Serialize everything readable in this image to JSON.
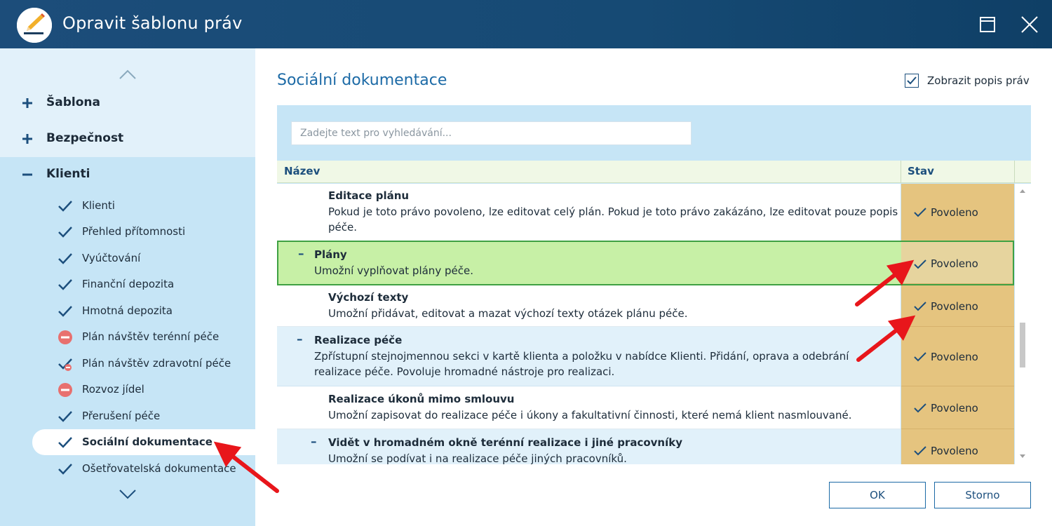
{
  "window": {
    "title": "Opravit šablonu práv"
  },
  "sidebar": {
    "groups": [
      {
        "label": "Šablona",
        "sign": "plus"
      },
      {
        "label": "Bezpečnost",
        "sign": "plus"
      },
      {
        "label": "Klienti",
        "sign": "minus"
      }
    ],
    "items": [
      {
        "label": "Klienti",
        "icon": "check-icon"
      },
      {
        "label": "Přehled přítomnosti",
        "icon": "check-icon"
      },
      {
        "label": "Vyúčtování",
        "icon": "check-icon"
      },
      {
        "label": "Finanční depozita",
        "icon": "check-icon"
      },
      {
        "label": "Hmotná depozita",
        "icon": "check-icon"
      },
      {
        "label": "Plán návštěv terénní péče",
        "icon": "denied-icon"
      },
      {
        "label": "Plán návštěv zdravotní péče",
        "icon": "partial-check-icon"
      },
      {
        "label": "Rozvoz jídel",
        "icon": "denied-icon"
      },
      {
        "label": "Přerušení péče",
        "icon": "check-icon"
      },
      {
        "label": "Sociální dokumentace",
        "icon": "check-icon",
        "selected": true
      },
      {
        "label": "Ošetřovatelská dokumentace",
        "icon": "check-icon"
      }
    ]
  },
  "main": {
    "title": "Sociální dokumentace",
    "show_description_label": "Zobrazit popis práv",
    "show_description_checked": true,
    "search_placeholder": "Zadejte text pro vyhledávání..."
  },
  "grid": {
    "columns": {
      "name": "Název",
      "status": "Stav"
    },
    "rows": [
      {
        "title": "Editace plánu",
        "description": "Pokud je toto právo povoleno, lze editovat celý plán. Pokud je toto právo zakázáno, lze editovat pouze popis péče.",
        "status": "Povoleno"
      },
      {
        "title": "Plány",
        "description": "Umožní vyplňovat plány péče.",
        "status": "Povoleno"
      },
      {
        "title": "Výchozí texty",
        "description": "Umožní přidávat, editovat a mazat výchozí texty otázek plánu péče.",
        "status": "Povoleno"
      },
      {
        "title": "Realizace péče",
        "description": "Zpřístupní stejnojmennou sekci v kartě klienta a položku v nabídce Klienti. Přidání, oprava a odebrání realizace péče. Povoluje hromadné nástroje pro realizaci.",
        "status": "Povoleno"
      },
      {
        "title": "Realizace úkonů mimo smlouvu",
        "description": "Umožní zapisovat do realizace péče i úkony a fakultativní činnosti, které nemá klient nasmlouvané.",
        "status": "Povoleno"
      },
      {
        "title": "Vidět v hromadném okně terénní realizace i jiné pracovníky",
        "description": "Umožní se podívat i na realizace péče jiných pracovníků.",
        "status": "Povoleno"
      }
    ]
  },
  "buttons": {
    "ok": "OK",
    "cancel": "Storno"
  },
  "colors": {
    "titlebar": "#164a74",
    "sidebar": "#c6e5f6",
    "accent": "#1c6aa6",
    "status_cell": "#e5c47f",
    "selected_row": "#c7f0a6",
    "annotation_arrow": "#e8161b"
  }
}
